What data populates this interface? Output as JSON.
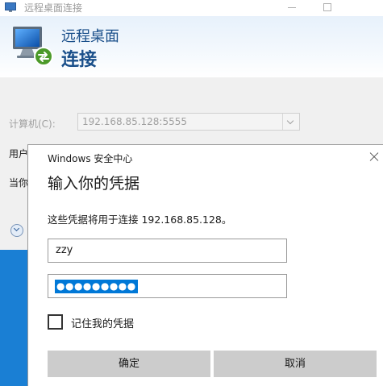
{
  "rdp": {
    "title": "远程桌面连接",
    "header_line1": "远程桌面",
    "header_line2": "连接",
    "computer_label": "计算机(C):",
    "computer_value": "192.168.85.128:5555",
    "user_label": "用户",
    "current_label": "当你",
    "logo_icon": "remote-desktop-monitor-icon",
    "colors": {
      "header_text": "#1a4f8a",
      "footer_band": "#1a7fd4"
    }
  },
  "credential_dialog": {
    "caption": "Windows 安全中心",
    "heading": "输入你的凭据",
    "subtitle": "这些凭据将用于连接 192.168.85.128。",
    "username_value": "zzy",
    "password_mask": "●●●●●●●●●",
    "remember_label": "记住我的凭据",
    "remember_checked": false,
    "ok_label": "确定",
    "cancel_label": "取消",
    "colors": {
      "selection": "#0078d7",
      "button_bg": "#cccccc"
    }
  }
}
